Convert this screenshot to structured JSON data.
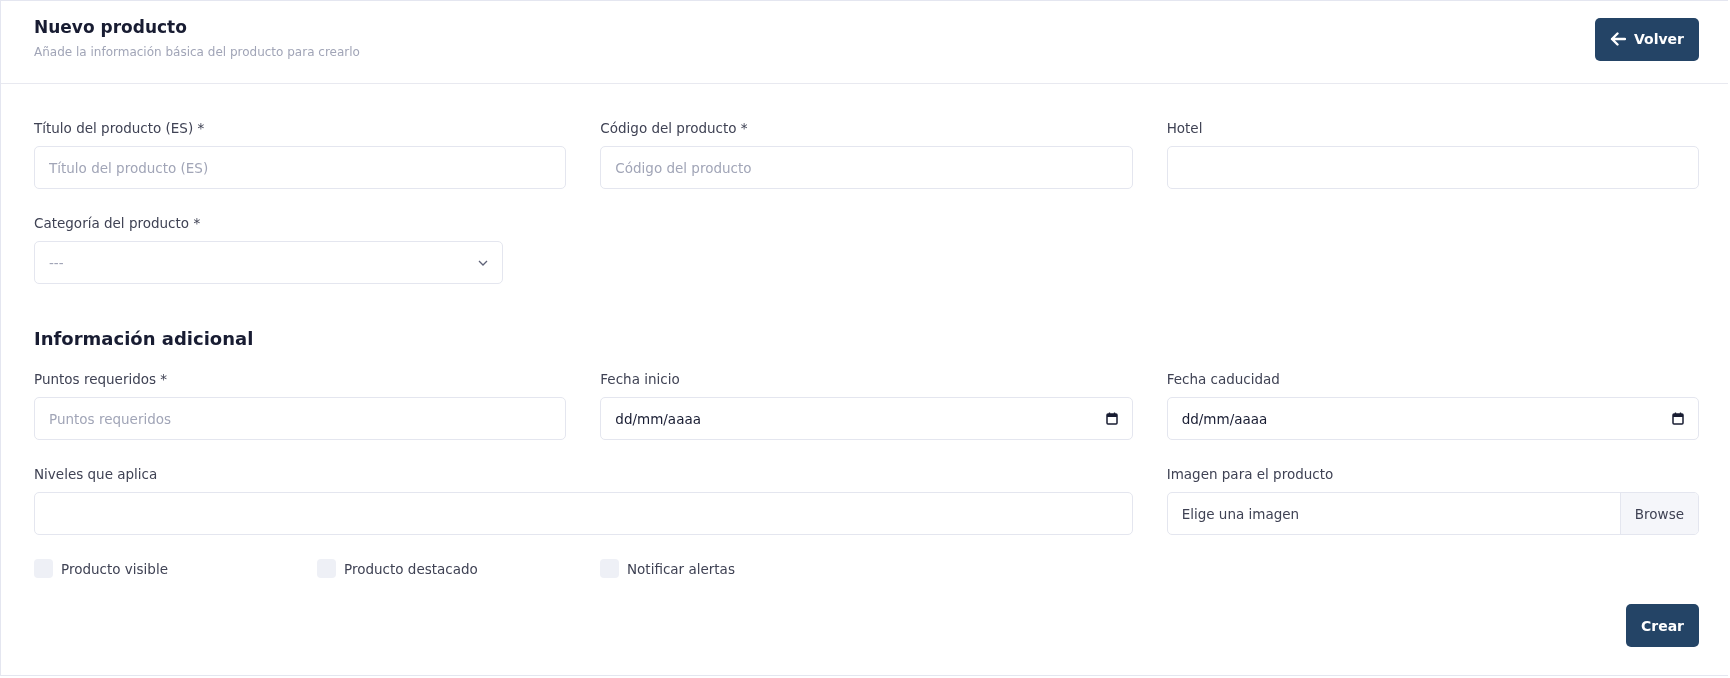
{
  "header": {
    "title": "Nuevo producto",
    "subtitle": "Añade la información básica del producto para crearlo",
    "back_button": "Volver"
  },
  "sections": [
    {
      "fields": [
        {
          "kind": "text",
          "label": "Título del producto (ES) *",
          "placeholder": "Título del producto (ES)"
        },
        {
          "kind": "text",
          "label": "Código del producto *",
          "placeholder": "Código del producto"
        },
        {
          "kind": "text",
          "label": "Hotel"
        },
        {
          "kind": "select",
          "label": "Categoría del producto *",
          "placeholder": "---"
        }
      ]
    },
    {
      "title": "Información adicional",
      "fields": [
        {
          "kind": "text",
          "label": "Puntos requeridos *",
          "placeholder": "Puntos requeridos"
        },
        {
          "kind": "date",
          "label": "Fecha inicio",
          "value": "dd/mm/aaaa"
        },
        {
          "kind": "date",
          "label": "Fecha caducidad",
          "value": "dd/mm/aaaa"
        },
        {
          "kind": "wide",
          "label": "Niveles que aplica"
        },
        {
          "kind": "file",
          "label": "Imagen para el producto",
          "value": "Elige una imagen",
          "button": "Browse"
        }
      ]
    }
  ],
  "checkboxes": [
    {
      "label": "Producto visible",
      "checked": false
    },
    {
      "label": "Producto destacado",
      "checked": false
    },
    {
      "label": "Notificar alertas",
      "checked": false
    }
  ],
  "submit_button": "Crear"
}
